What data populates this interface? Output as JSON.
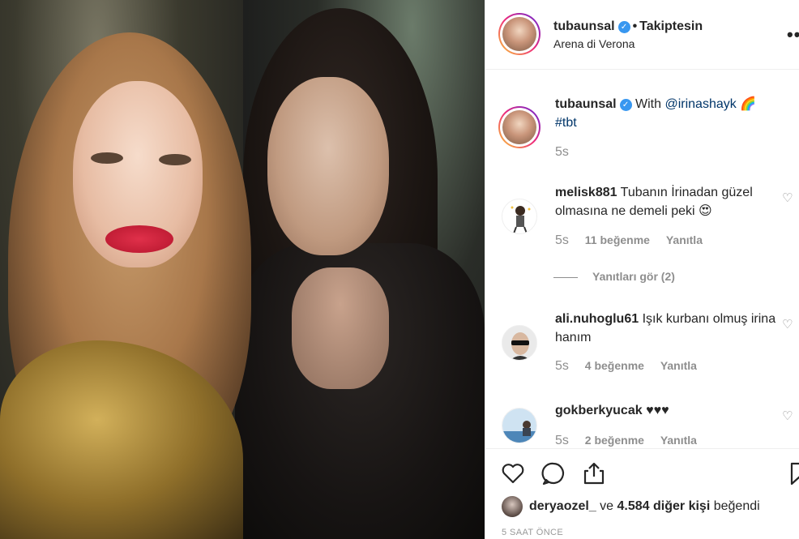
{
  "post": {
    "username": "tubaunsal",
    "follow_status": "Takiptesin",
    "location": "Arena di Verona",
    "more_icon": "more-options-icon"
  },
  "caption": {
    "username": "tubaunsal",
    "text_prefix": "With",
    "mention": "@irinashayk",
    "emoji": "🌈",
    "hashtag": "#tbt",
    "time": "5s"
  },
  "comments": [
    {
      "username": "melisk881",
      "text": "Tubanın İrinadan güzel olmasına ne demeli peki 😍",
      "time": "5s",
      "likes": "11 beğenme",
      "reply": "Yanıtla"
    },
    {
      "username": "ali.nuhoglu61",
      "text": "Işık kurbanı olmuş irina hanım",
      "time": "5s",
      "likes": "4 beğenme",
      "reply": "Yanıtla"
    },
    {
      "username": "gokberkyucak",
      "text": "♥♥♥",
      "time": "5s",
      "likes": "2 beğenme",
      "reply": "Yanıtla"
    }
  ],
  "view_replies": "Yanıtları gör (2)",
  "likes": {
    "user": "deryaozel_",
    "connector": "ve",
    "count": "4.584 diğer kişi",
    "suffix": "beğendi"
  },
  "timestamp": "5 SAAT ÖNCE"
}
